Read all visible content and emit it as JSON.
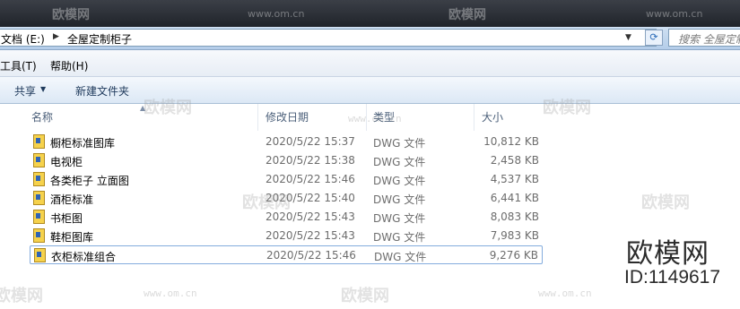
{
  "watermark": {
    "brand": "欧模网",
    "url": "www.om.cn",
    "id_label": "ID:1149617"
  },
  "address_bar": {
    "crumbs": [
      "文档 (E:)",
      "全屋定制柜子"
    ],
    "search_placeholder": "搜索 全屋定制柜子",
    "refresh_icon": "refresh-icon",
    "dropdown_icon": "chevron-down-icon"
  },
  "menu": {
    "items": [
      "工具(T)",
      "帮助(H)"
    ]
  },
  "toolbar": {
    "share_label": "共享",
    "new_folder_label": "新建文件夹"
  },
  "columns": {
    "name": "名称",
    "date": "修改日期",
    "type": "类型",
    "size": "大小"
  },
  "files": [
    {
      "name": "橱柜标准图库",
      "date": "2020/5/22 15:37",
      "type": "DWG 文件",
      "size": "10,812 KB"
    },
    {
      "name": "电视柜",
      "date": "2020/5/22 15:38",
      "type": "DWG 文件",
      "size": "2,458 KB"
    },
    {
      "name": "各类柜子  立面图",
      "date": "2020/5/22 15:46",
      "type": "DWG 文件",
      "size": "4,537 KB"
    },
    {
      "name": "酒柜标准",
      "date": "2020/5/22 15:40",
      "type": "DWG 文件",
      "size": "6,441 KB"
    },
    {
      "name": "书柜图",
      "date": "2020/5/22 15:43",
      "type": "DWG 文件",
      "size": "8,083 KB"
    },
    {
      "name": "鞋柜图库",
      "date": "2020/5/22 15:43",
      "type": "DWG 文件",
      "size": "7,983 KB"
    },
    {
      "name": "衣柜标准组合",
      "date": "2020/5/22 15:46",
      "type": "DWG 文件",
      "size": "9,276 KB"
    }
  ],
  "selected_index": 6,
  "colors": {
    "title_bar": "#2b2f36",
    "address_bg": "#c3d7ee",
    "selection_border": "#84acdd",
    "file_icon": "#f6d24c"
  }
}
